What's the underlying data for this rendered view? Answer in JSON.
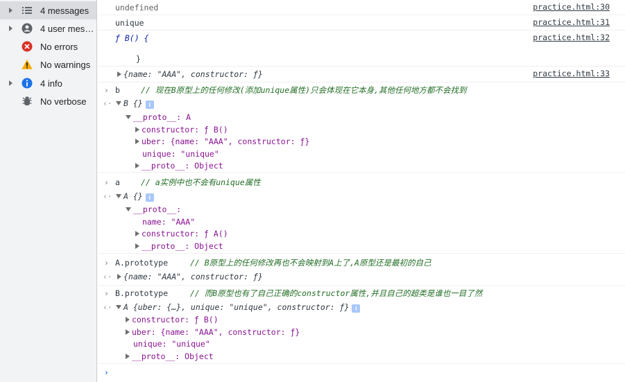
{
  "sidebar": {
    "items": [
      {
        "label": "4 messages",
        "icon": "list-icon",
        "expandable": true,
        "selected": true
      },
      {
        "label": "4 user mess…",
        "icon": "user-icon",
        "expandable": true,
        "selected": false
      },
      {
        "label": "No errors",
        "icon": "error-icon",
        "expandable": false,
        "selected": false
      },
      {
        "label": "No warnings",
        "icon": "warning-icon",
        "expandable": false,
        "selected": false
      },
      {
        "label": "4 info",
        "icon": "info-icon",
        "expandable": true,
        "selected": false
      },
      {
        "label": "No verbose",
        "icon": "bug-icon",
        "expandable": false,
        "selected": false
      }
    ]
  },
  "colors": {
    "error": "#d93025",
    "warning": "#f9ab00",
    "info": "#1a73e8",
    "link_source": "#303942"
  },
  "console": {
    "log1": {
      "text": "undefined",
      "source": "practice.html:30"
    },
    "log2": {
      "text": "unique",
      "source": "practice.html:31"
    },
    "log3": {
      "line1": "ƒ B() {",
      "line2": "}",
      "source": "practice.html:32"
    },
    "log4": {
      "text": "{name: \"AAA\", constructor: ƒ}",
      "source": "practice.html:33"
    },
    "cmd1": {
      "code": "b",
      "comment": "// 现在B原型上的任何修改(添加unique属性)只会体现在它本身,其他任何地方都不会找到"
    },
    "res1": {
      "summary": "B {}",
      "proto": "__proto__: A",
      "constructor": "constructor: ƒ B()",
      "uber": "uber: {name: \"AAA\", constructor: ƒ}",
      "unique": "unique: \"unique\"",
      "proto2": "__proto__: Object"
    },
    "cmd2": {
      "code": "a",
      "comment": "// a实例中也不会有unique属性"
    },
    "res2": {
      "summary": "A {}",
      "proto": "__proto__:",
      "name": "name: \"AAA\"",
      "constructor": "constructor: ƒ A()",
      "proto2": "__proto__: Object"
    },
    "cmd3": {
      "code": "A.prototype",
      "comment": "// B原型上的任何修改再也不会映射到A上了,A原型还是最初的自己"
    },
    "res3": {
      "summary": "{name: \"AAA\", constructor: ƒ}"
    },
    "cmd4": {
      "code": "B.prototype",
      "comment": "// 而B原型也有了自己正确的constructor属性,并且自己的超类是谁也一目了然"
    },
    "res4": {
      "summary": "A {uber: {…}, unique: \"unique\", constructor: ƒ}",
      "constructor": "constructor: ƒ B()",
      "uber": "uber: {name: \"AAA\", constructor: ƒ}",
      "unique": "unique: \"unique\"",
      "proto2": "__proto__: Object"
    },
    "prompt_symbol": "›",
    "return_symbol": "‹·",
    "info_badge": "i"
  }
}
